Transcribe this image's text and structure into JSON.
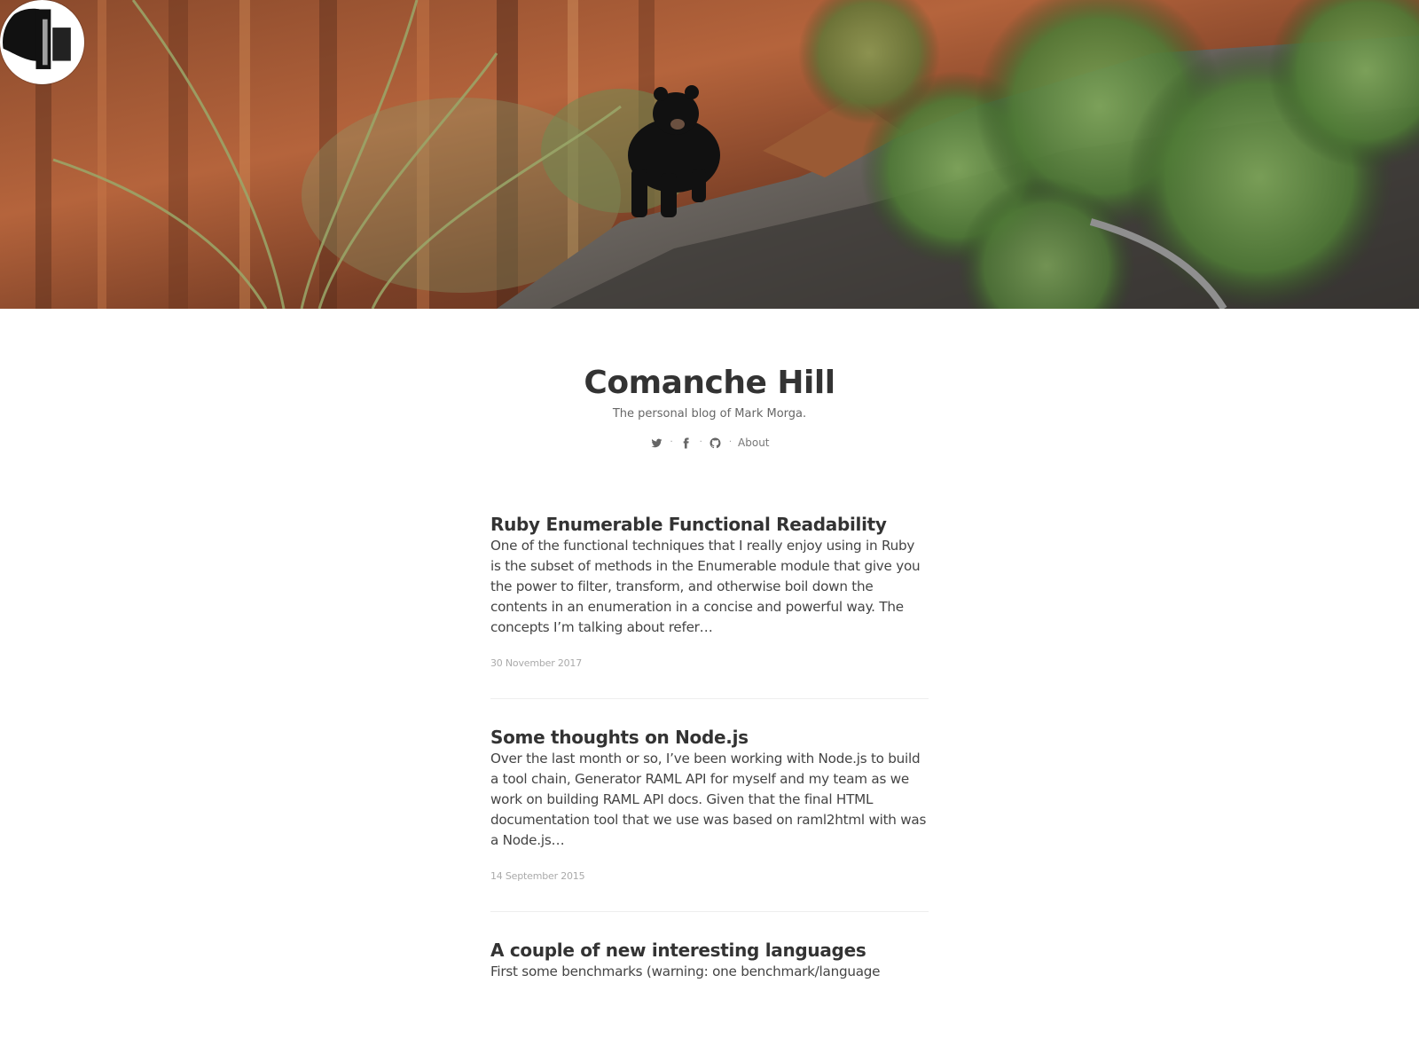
{
  "site": {
    "title": "Comanche Hill",
    "description": "The personal blog of Mark Morga."
  },
  "nav": {
    "icons": [
      "twitter-icon",
      "facebook-icon",
      "github-icon"
    ],
    "separator": "·",
    "about_label": "About"
  },
  "posts": [
    {
      "title": "Ruby Enumerable Functional Readability",
      "excerpt": "One of the functional techniques that I really enjoy using in Ruby is the subset of methods in the Enumerable module that give you the power to filter, transform, and otherwise boil down the contents in an enumeration in a concise and powerful way. The concepts I’m talking about refer…",
      "date": "30 November 2017"
    },
    {
      "title": "Some thoughts on Node.js",
      "excerpt": "Over the last month or so, I’ve been working with Node.js to build a tool chain, Generator RAML API for myself and my team as we work on building RAML API docs. Given that the final HTML documentation tool that we use was based on raml2html with was a Node.js…",
      "date": "14 September 2015"
    },
    {
      "title": "A couple of new interesting languages",
      "excerpt": "First some benchmarks (warning: one benchmark/language",
      "date": ""
    }
  ]
}
